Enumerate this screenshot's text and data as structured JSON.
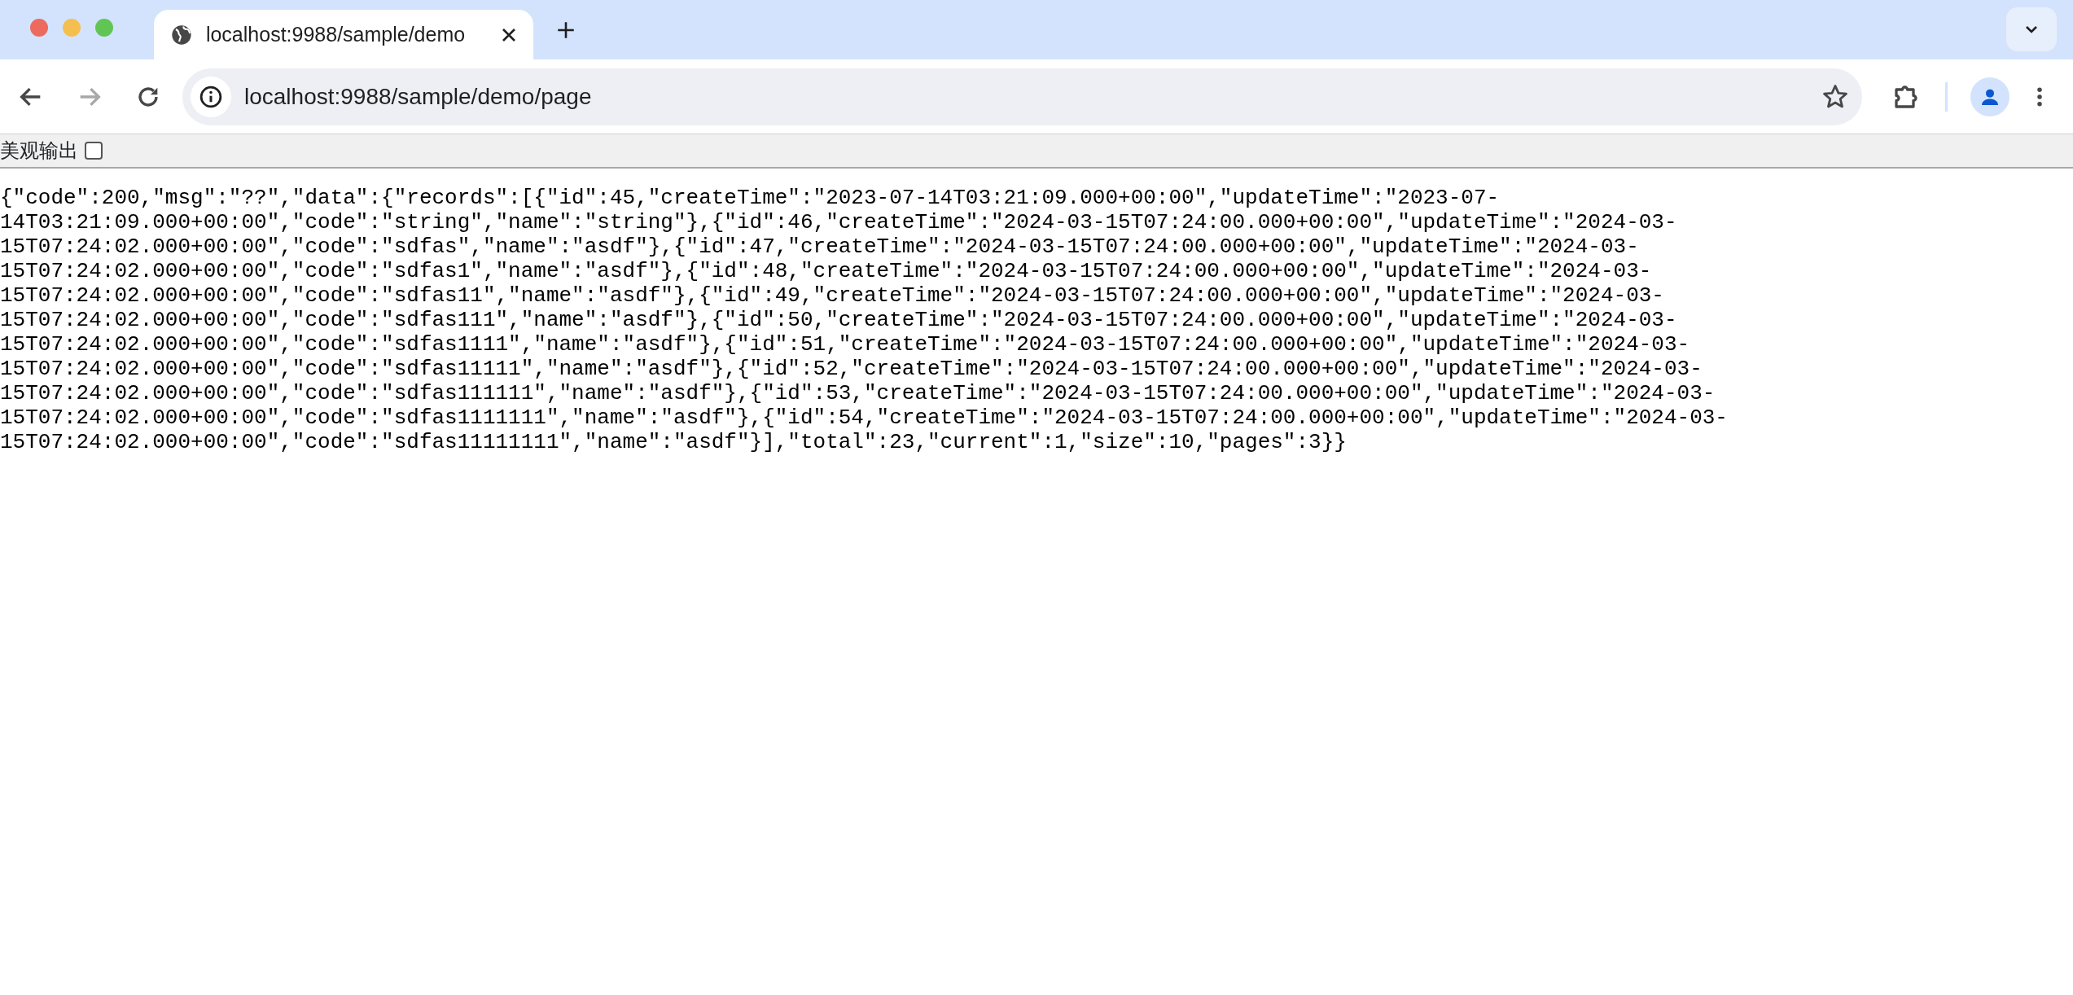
{
  "browser": {
    "tab": {
      "title": "localhost:9988/sample/demo"
    },
    "nav": [
      {
        "kind": "back",
        "disabled": false
      },
      {
        "kind": "forward",
        "disabled": true
      },
      {
        "kind": "reload",
        "disabled": false
      }
    ],
    "address": "localhost:9988/sample/demo/page"
  },
  "toolbar": {
    "label": "美观输出",
    "checked": false
  },
  "body_lines": [
    "{\"code\":200,\"msg\":\"??\",\"data\":{\"records\":[{\"id\":45,\"createTime\":\"2023-07-14T03:21:09.000+00:00\",\"updateTime\":\"2023-07-",
    "14T03:21:09.000+00:00\",\"code\":\"string\",\"name\":\"string\"},{\"id\":46,\"createTime\":\"2024-03-15T07:24:00.000+00:00\",\"updateTime\":\"2024-03-",
    "15T07:24:02.000+00:00\",\"code\":\"sdfas\",\"name\":\"asdf\"},{\"id\":47,\"createTime\":\"2024-03-15T07:24:00.000+00:00\",\"updateTime\":\"2024-03-",
    "15T07:24:02.000+00:00\",\"code\":\"sdfas1\",\"name\":\"asdf\"},{\"id\":48,\"createTime\":\"2024-03-15T07:24:00.000+00:00\",\"updateTime\":\"2024-03-",
    "15T07:24:02.000+00:00\",\"code\":\"sdfas11\",\"name\":\"asdf\"},{\"id\":49,\"createTime\":\"2024-03-15T07:24:00.000+00:00\",\"updateTime\":\"2024-03-",
    "15T07:24:02.000+00:00\",\"code\":\"sdfas111\",\"name\":\"asdf\"},{\"id\":50,\"createTime\":\"2024-03-15T07:24:00.000+00:00\",\"updateTime\":\"2024-03-",
    "15T07:24:02.000+00:00\",\"code\":\"sdfas1111\",\"name\":\"asdf\"},{\"id\":51,\"createTime\":\"2024-03-15T07:24:00.000+00:00\",\"updateTime\":\"2024-03-",
    "15T07:24:02.000+00:00\",\"code\":\"sdfas11111\",\"name\":\"asdf\"},{\"id\":52,\"createTime\":\"2024-03-15T07:24:00.000+00:00\",\"updateTime\":\"2024-03-",
    "15T07:24:02.000+00:00\",\"code\":\"sdfas111111\",\"name\":\"asdf\"},{\"id\":53,\"createTime\":\"2024-03-15T07:24:00.000+00:00\",\"updateTime\":\"2024-03-",
    "15T07:24:02.000+00:00\",\"code\":\"sdfas1111111\",\"name\":\"asdf\"},{\"id\":54,\"createTime\":\"2024-03-15T07:24:00.000+00:00\",\"updateTime\":\"2024-03-",
    "15T07:24:02.000+00:00\",\"code\":\"sdfas11111111\",\"name\":\"asdf\"}],\"total\":23,\"current\":1,\"size\":10,\"pages\":3}}"
  ]
}
